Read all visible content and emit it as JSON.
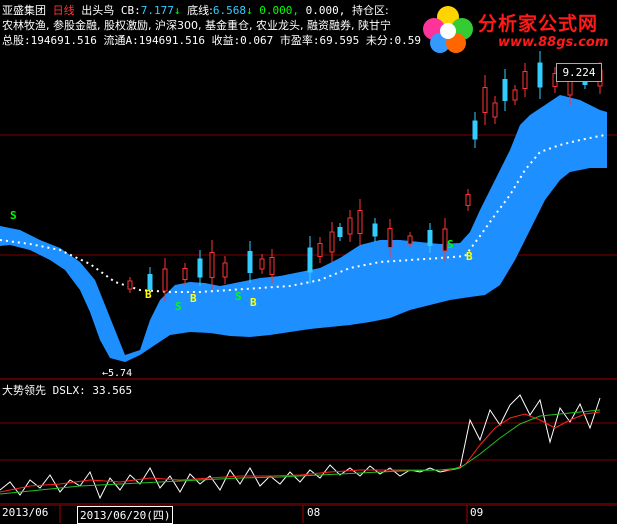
{
  "header": {
    "stock_name": "亚盛集团",
    "period": "日线",
    "formula": "出头鸟",
    "cb_label": "CB:",
    "cb_value": "7.177",
    "bottom_label": "底线:",
    "bottom_value": "6.568",
    "v1": "0.000,",
    "v2": "0.000,",
    "position_label": "持仓区:",
    "tags": "农林牧渔, 参股金融, 股权激励, 沪深300, 基金重仓, 农业龙头, 融资融券, 陕甘宁",
    "stats": "总股:194691.516 流通A:194691.516 收益:0.067 市盈率:69.595 未分:0.59"
  },
  "price_box": "9.224",
  "low_marker": "←5.74",
  "signals": {
    "buy": "B",
    "sell": "S"
  },
  "indicator": {
    "name": "大势领先",
    "code": "DSLX:",
    "value": "33.565"
  },
  "axis": {
    "d1": "2013/06",
    "selected": "2013/06/20(四)",
    "d3": "08",
    "d4": "09"
  },
  "logo": {
    "brand": "分析家公式网",
    "url": "www.88gs.com"
  },
  "colors": {
    "band": "#1e8fff",
    "up": "#ff3333",
    "down": "#33ccff",
    "accent_red": "#ff1a1a",
    "sell_signal": "#00ff00",
    "buy_signal": "#ffff00"
  }
}
